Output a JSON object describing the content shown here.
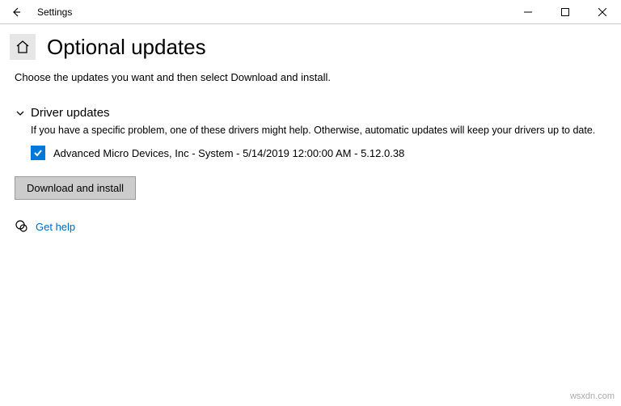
{
  "titlebar": {
    "app_title": "Settings"
  },
  "header": {
    "page_title": "Optional updates"
  },
  "content": {
    "subtitle": "Choose the updates you want and then select Download and install.",
    "section": {
      "title": "Driver updates",
      "description": "If you have a specific problem, one of these drivers might help. Otherwise, automatic updates will keep your drivers up to date.",
      "items": [
        {
          "label": "Advanced Micro Devices, Inc - System - 5/14/2019 12:00:00 AM - 5.12.0.38",
          "checked": true
        }
      ]
    },
    "download_button": "Download and install",
    "help_link": "Get help"
  },
  "watermark": "wsxdn.com"
}
